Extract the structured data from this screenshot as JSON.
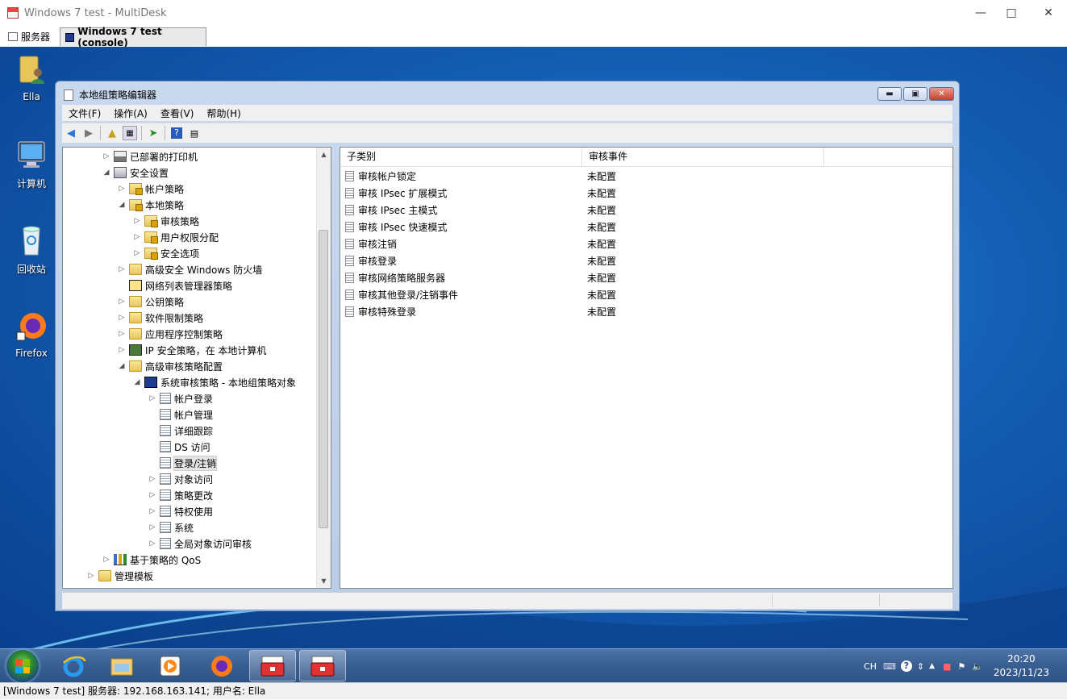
{
  "window": {
    "title": "Windows 7 test - MultiDesk"
  },
  "tabs": [
    {
      "label": "服务器"
    },
    {
      "label": "Windows 7 test (console)"
    }
  ],
  "desktop": {
    "icons": [
      {
        "label": "Ella",
        "icon": "user-folder-icon"
      },
      {
        "label": "计算机",
        "icon": "computer-icon"
      },
      {
        "label": "回收站",
        "icon": "recycle-bin-icon"
      },
      {
        "label": "Firefox",
        "icon": "firefox-icon"
      }
    ]
  },
  "gpe": {
    "title": "本地组策略编辑器",
    "menu": [
      "文件(F)",
      "操作(A)",
      "查看(V)",
      "帮助(H)"
    ],
    "tree": [
      {
        "label": "已部署的打印机",
        "expander": "▷",
        "icon": "printer"
      },
      {
        "label": "安全设置",
        "expander": "◢",
        "icon": "security"
      },
      {
        "label": "帐户策略",
        "expander": "▷",
        "icon": "lockfolder"
      },
      {
        "label": "本地策略",
        "expander": "◢",
        "icon": "lockfolder"
      },
      {
        "label": "审核策略",
        "expander": "▷",
        "icon": "lockfolder"
      },
      {
        "label": "用户权限分配",
        "expander": "▷",
        "icon": "lockfolder"
      },
      {
        "label": "安全选项",
        "expander": "▷",
        "icon": "lockfolder"
      },
      {
        "label": "高级安全 Windows 防火墙",
        "expander": "▷",
        "icon": "folder"
      },
      {
        "label": "网络列表管理器策略",
        "expander": "",
        "icon": "netlist"
      },
      {
        "label": "公钥策略",
        "expander": "▷",
        "icon": "folder"
      },
      {
        "label": "软件限制策略",
        "expander": "▷",
        "icon": "folder"
      },
      {
        "label": "应用程序控制策略",
        "expander": "▷",
        "icon": "folder"
      },
      {
        "label": "IP 安全策略，在 本地计算机",
        "expander": "▷",
        "icon": "ipsec"
      },
      {
        "label": "高级审核策略配置",
        "expander": "◢",
        "icon": "folder"
      },
      {
        "label": "系统审核策略 - 本地组策略对象",
        "expander": "◢",
        "icon": "sysaudit"
      },
      {
        "label": "帐户登录",
        "expander": "▷",
        "icon": "audit"
      },
      {
        "label": "帐户管理",
        "expander": "",
        "icon": "audit"
      },
      {
        "label": "详细跟踪",
        "expander": "",
        "icon": "audit"
      },
      {
        "label": "DS 访问",
        "expander": "",
        "icon": "audit"
      },
      {
        "label": "登录/注销",
        "expander": "",
        "icon": "audit"
      },
      {
        "label": "对象访问",
        "expander": "▷",
        "icon": "audit"
      },
      {
        "label": "策略更改",
        "expander": "▷",
        "icon": "audit"
      },
      {
        "label": "特权使用",
        "expander": "▷",
        "icon": "audit"
      },
      {
        "label": "系统",
        "expander": "▷",
        "icon": "audit"
      },
      {
        "label": "全局对象访问审核",
        "expander": "▷",
        "icon": "audit"
      },
      {
        "label": "基于策略的 QoS",
        "expander": "▷",
        "icon": "qos"
      },
      {
        "label": "管理模板",
        "expander": "▷",
        "icon": "folder"
      }
    ],
    "list": {
      "columns": [
        "子类别",
        "审核事件"
      ],
      "rows": [
        {
          "name": "审核帐户锁定",
          "value": "未配置"
        },
        {
          "name": "审核 IPsec 扩展模式",
          "value": "未配置"
        },
        {
          "name": "审核 IPsec 主模式",
          "value": "未配置"
        },
        {
          "name": "审核 IPsec 快速模式",
          "value": "未配置"
        },
        {
          "name": "审核注销",
          "value": "未配置"
        },
        {
          "name": "审核登录",
          "value": "未配置"
        },
        {
          "name": "审核网络策略服务器",
          "value": "未配置"
        },
        {
          "name": "审核其他登录/注销事件",
          "value": "未配置"
        },
        {
          "name": "审核特殊登录",
          "value": "未配置"
        }
      ]
    }
  },
  "taskbar": {
    "tray_lang": "CH",
    "clock_time": "20:20",
    "clock_date": "2023/11/23"
  },
  "status": {
    "text": "[Windows 7 test] 服务器: 192.168.163.141; 用户名: Ella"
  }
}
